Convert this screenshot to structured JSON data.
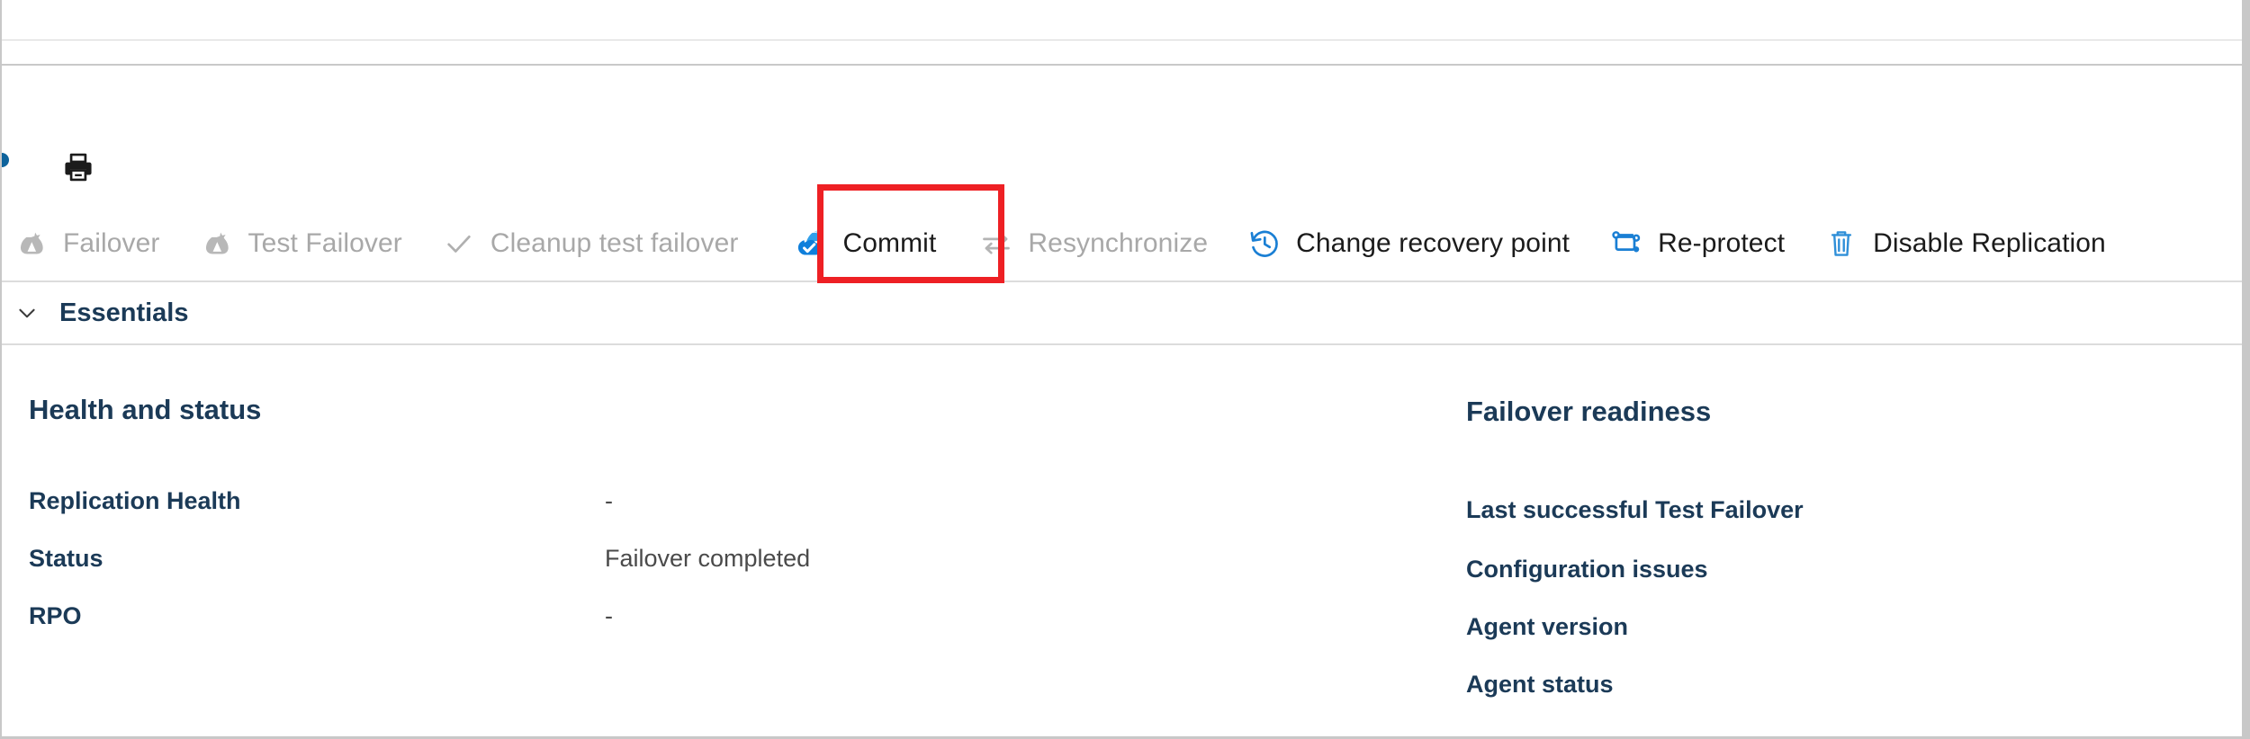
{
  "colors": {
    "highlight_box": "#EE2024",
    "accent_blue": "#0078D4",
    "heading_blue": "#1B3A57",
    "disabled_grey": "#A8A8A8",
    "rule_grey": "#D6D6D6"
  },
  "command_bar": {
    "print_icon": "print-icon",
    "clipped_icon": "clipped-partial-icon"
  },
  "toolbar": {
    "items": [
      {
        "label": "Failover",
        "icon": "failover-icon",
        "enabled": false
      },
      {
        "label": "Test Failover",
        "icon": "test-failover-icon",
        "enabled": false
      },
      {
        "label": "Cleanup test failover",
        "icon": "checkmark-icon",
        "enabled": false
      },
      {
        "label": "Commit",
        "icon": "commit-cloud-check-icon",
        "enabled": true
      },
      {
        "label": "Resynchronize",
        "icon": "resynchronize-arrows-icon",
        "enabled": false
      },
      {
        "label": "Change recovery point",
        "icon": "clock-history-icon",
        "enabled": true
      },
      {
        "label": "Re-protect",
        "icon": "re-protect-icon",
        "enabled": true
      },
      {
        "label": "Disable Replication",
        "icon": "trash-icon",
        "enabled": true
      }
    ],
    "highlighted_item": "Commit"
  },
  "essentials": {
    "label": "Essentials",
    "chevron_icon": "chevron-down-icon",
    "expanded": true
  },
  "health_and_status": {
    "title": "Health and status",
    "rows": [
      {
        "key": "Replication Health",
        "value": "-"
      },
      {
        "key": "Status",
        "value": "Failover completed"
      },
      {
        "key": "RPO",
        "value": "-"
      }
    ]
  },
  "failover_readiness": {
    "title": "Failover readiness",
    "rows": [
      {
        "key": "Last successful Test Failover",
        "value": ""
      },
      {
        "key": "Configuration issues",
        "value": ""
      },
      {
        "key": "Agent version",
        "value": ""
      },
      {
        "key": "Agent status",
        "value": ""
      }
    ]
  }
}
